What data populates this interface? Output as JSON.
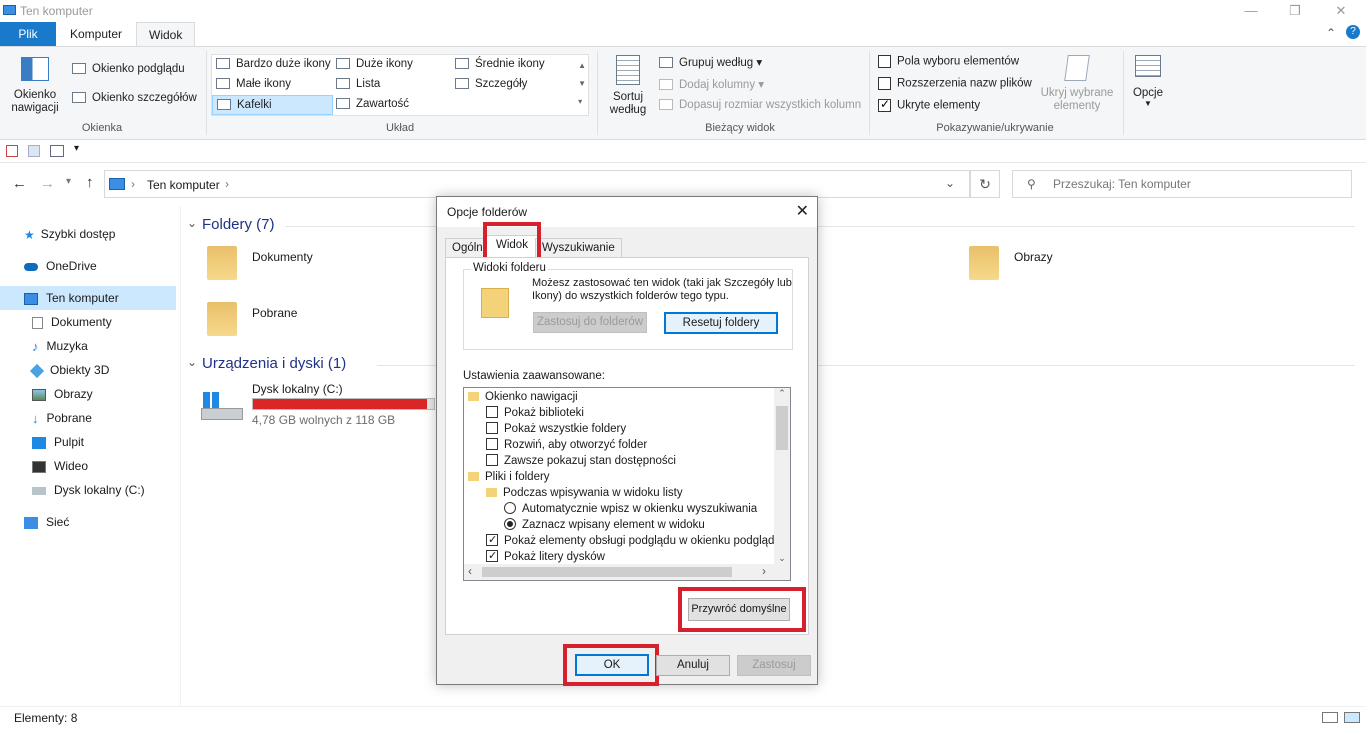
{
  "window": {
    "title": "Ten komputer",
    "minimize": "—",
    "maximize": "❐",
    "close": "✕"
  },
  "ribbon_tabs": {
    "file": "Plik",
    "computer": "Komputer",
    "view": "Widok"
  },
  "ribbon": {
    "panes": {
      "nav_pane": "Okienko nawigacji",
      "preview": "Okienko podglądu",
      "details": "Okienko szczegółów",
      "label": "Okienka"
    },
    "layout": {
      "items": [
        "Bardzo duże ikony",
        "Duże ikony",
        "Średnie ikony",
        "Małe ikony",
        "Lista",
        "Szczegóły",
        "Kafelki",
        "Zawartość"
      ],
      "label": "Układ"
    },
    "current_view": {
      "sort": "Sortuj według",
      "group": "Grupuj według",
      "add_cols": "Dodaj kolumny",
      "fit_cols": "Dopasuj rozmiar wszystkich kolumn",
      "label": "Bieżący widok"
    },
    "show_hide": {
      "checkboxes": "Pola wyboru elementów",
      "extensions": "Rozszerzenia nazw plików",
      "hidden": "Ukryte elementy",
      "hide_selected": "Ukryj wybrane elementy",
      "label": "Pokazywanie/ukrywanie"
    },
    "options": "Opcje"
  },
  "address": {
    "path": "Ten komputer",
    "search_placeholder": "Przeszukaj: Ten komputer"
  },
  "nav": {
    "items": [
      "Szybki dostęp",
      "OneDrive",
      "Ten komputer",
      "Dokumenty",
      "Muzyka",
      "Obiekty 3D",
      "Obrazy",
      "Pobrane",
      "Pulpit",
      "Wideo",
      "Dysk lokalny (C:)",
      "Sieć"
    ]
  },
  "content": {
    "folders_header": "Foldery (7)",
    "folders": [
      "Dokumenty",
      "Pobrane",
      "Obrazy"
    ],
    "devices_header": "Urządzenia i dyski (1)",
    "drive": {
      "name": "Dysk lokalny (C:)",
      "free": "4,78 GB wolnych z 118 GB",
      "used_fraction": 0.96
    }
  },
  "status": {
    "elements": "Elementy: 8"
  },
  "dialog": {
    "title": "Opcje folderów",
    "tabs": [
      "Ogólne",
      "Widok",
      "Wyszukiwanie"
    ],
    "folder_views_title": "Widoki folderu",
    "folder_views_desc_1": "Możesz zastosować ten widok (taki jak Szczegóły lub",
    "folder_views_desc_2": "Ikony) do wszystkich folderów tego typu.",
    "apply_btn": "Zastosuj do folderów",
    "reset_btn": "Resetuj foldery",
    "advanced_label": "Ustawienia zaawansowane:",
    "tree": [
      {
        "text": "Okienko nawigacji",
        "kind": "folder",
        "indent": 0
      },
      {
        "text": "Pokaż biblioteki",
        "kind": "check",
        "checked": false,
        "indent": 1
      },
      {
        "text": "Pokaż wszystkie foldery",
        "kind": "check",
        "checked": false,
        "indent": 1
      },
      {
        "text": "Rozwiń, aby otworzyć folder",
        "kind": "check",
        "checked": false,
        "indent": 1
      },
      {
        "text": "Zawsze pokazuj stan dostępności",
        "kind": "check",
        "checked": false,
        "indent": 1
      },
      {
        "text": "Pliki i foldery",
        "kind": "folder",
        "indent": 0
      },
      {
        "text": "Podczas wpisywania w widoku listy",
        "kind": "folder",
        "indent": 1
      },
      {
        "text": "Automatycznie wpisz w okienku wyszukiwania",
        "kind": "radio",
        "checked": false,
        "indent": 2
      },
      {
        "text": "Zaznacz wpisany element w widoku",
        "kind": "radio",
        "checked": true,
        "indent": 2
      },
      {
        "text": "Pokaż elementy obsługi podglądu w okienku podglądu",
        "kind": "check",
        "checked": true,
        "indent": 1
      },
      {
        "text": "Pokaż litery dysków",
        "kind": "check",
        "checked": true,
        "indent": 1
      }
    ],
    "restore_btn": "Przywróć domyślne",
    "ok": "OK",
    "cancel": "Anuluj",
    "apply": "Zastosuj"
  }
}
